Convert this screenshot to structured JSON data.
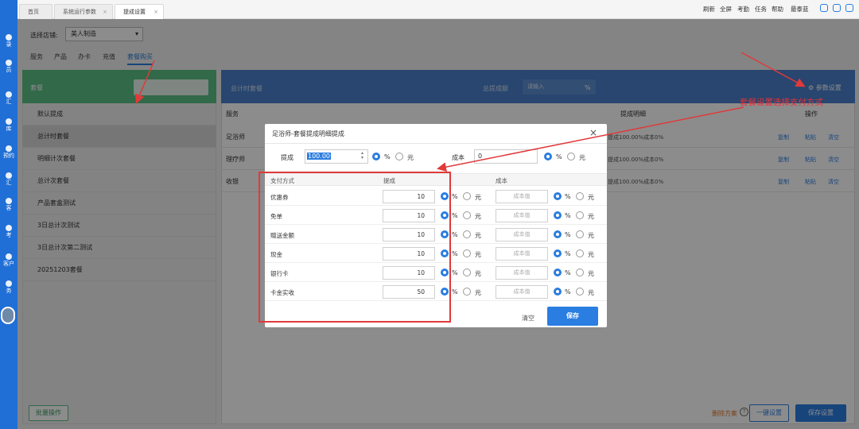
{
  "leftbar": {
    "items": [
      "录",
      "员",
      "汇",
      "库",
      "预约",
      "汇",
      "客",
      "考",
      "客户",
      "务"
    ]
  },
  "tabs": [
    {
      "label": "首页"
    },
    {
      "label": "系统运行参数"
    },
    {
      "label": "提成设置"
    }
  ],
  "topright": {
    "links": [
      "刷新",
      "全屏",
      "考勤",
      "任务",
      "帮助",
      "最泰蓝"
    ]
  },
  "shop": {
    "label": "选择店铺:",
    "value": "美人制造"
  },
  "content_tabs": [
    "服务",
    "产品",
    "办卡",
    "充值",
    "套餐购买"
  ],
  "left": {
    "title": "套餐",
    "items": [
      "默认提成",
      "总计时套餐",
      "明细计次套餐",
      "总计次套餐",
      "产品套盒测试",
      "3日总计次测试",
      "3日总计次第二测试",
      "20251203套餐"
    ],
    "batch": "批量操作"
  },
  "right": {
    "title": "总计时套餐",
    "total_label": "总提成额",
    "input_placeholder": "请输入",
    "pct": "%",
    "param_settings": "参数设置",
    "headers": [
      "服务",
      "提成明细",
      "操作"
    ],
    "rows": [
      {
        "name": "足浴师",
        "detail": "提成100.00%成本0%",
        "ops": [
          "复制",
          "粘贴",
          "清空"
        ]
      },
      {
        "name": "理疗师",
        "detail": "提成100.00%成本0%",
        "ops": [
          "复制",
          "粘贴",
          "清空"
        ]
      },
      {
        "name": "收银",
        "detail": "提成100.00%成本0%",
        "ops": [
          "复制",
          "粘贴",
          "清空"
        ]
      }
    ]
  },
  "footer": {
    "delete_plan": "删除方案",
    "one_key": "一键设置",
    "save": "保存设置"
  },
  "annotation": "套餐设置选择支付方式",
  "modal": {
    "title": "足浴师-套餐提成明细提成",
    "close": "×",
    "tc_label": "提成",
    "tc_value": "100.00",
    "cb_label": "成本",
    "cb_value": "0",
    "unit_pct": "%",
    "unit_yuan": "元",
    "headers": [
      "支付方式",
      "提成",
      "成本"
    ],
    "cost_placeholder": "成本值",
    "rows": [
      {
        "method": "优惠券",
        "value": "10"
      },
      {
        "method": "免单",
        "value": "10"
      },
      {
        "method": "赠送金额",
        "value": "10"
      },
      {
        "method": "现金",
        "value": "10"
      },
      {
        "method": "银行卡",
        "value": "10"
      },
      {
        "method": "卡金实收",
        "value": "50"
      }
    ],
    "clear": "清空",
    "save": "保存"
  },
  "colors": {
    "primary": "#2a7de1",
    "green": "#5abf86",
    "red": "#e03a3a"
  }
}
